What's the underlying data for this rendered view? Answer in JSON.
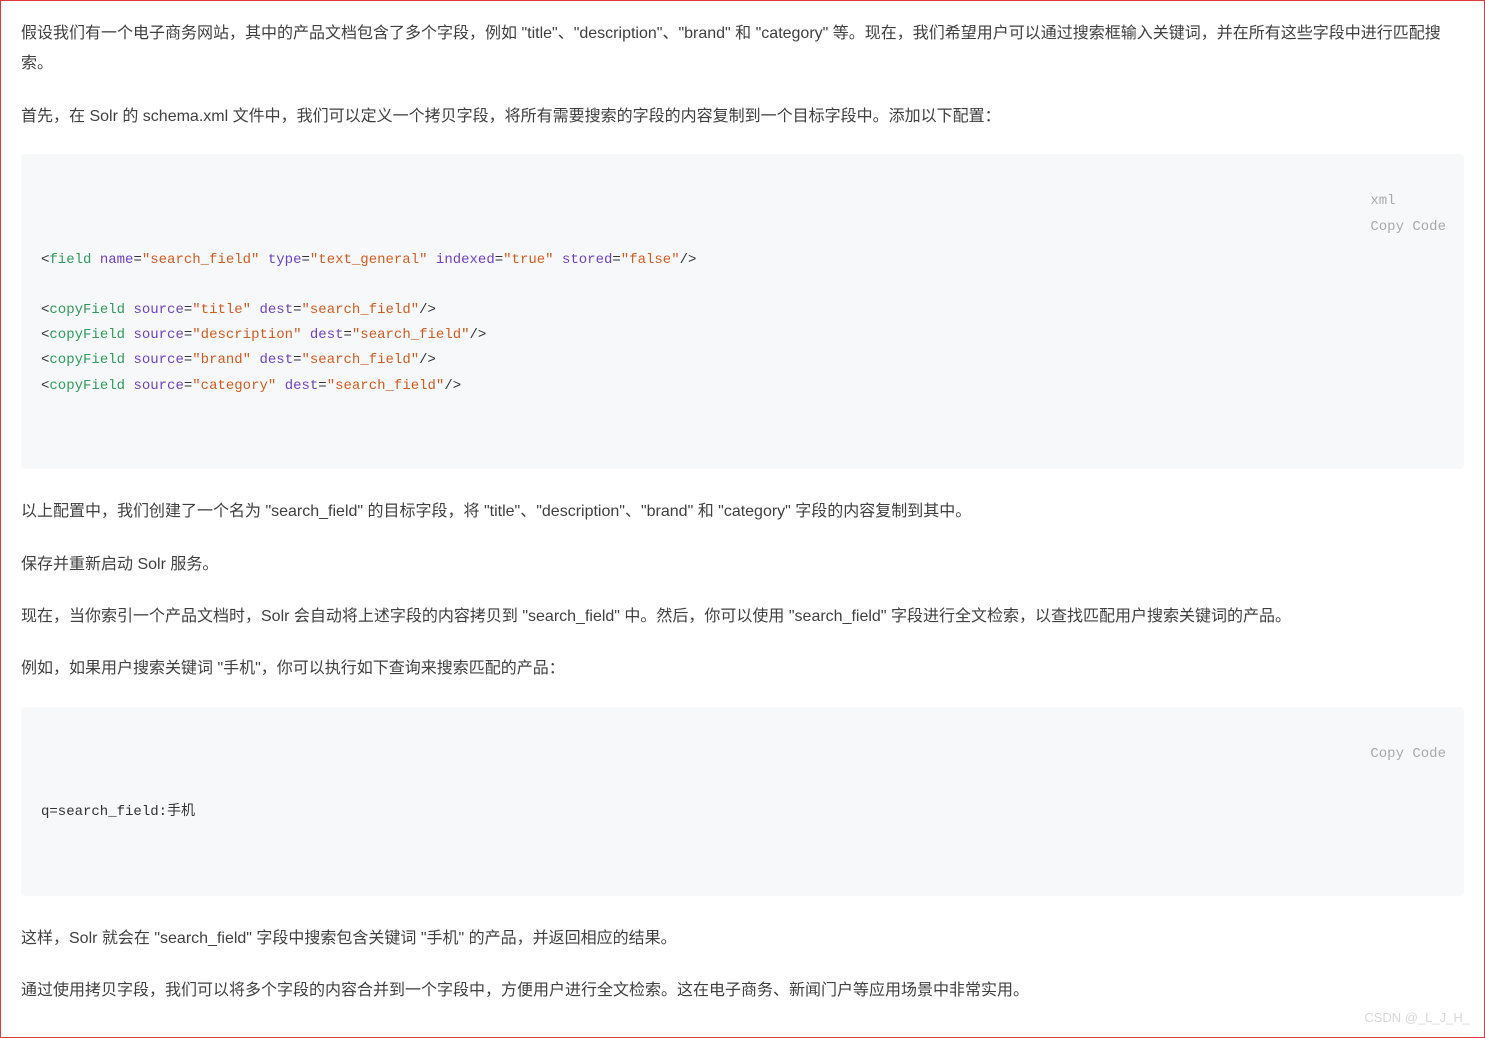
{
  "paragraphs": {
    "p1": "假设我们有一个电子商务网站，其中的产品文档包含了多个字段，例如 \"title\"、\"description\"、\"brand\" 和 \"category\" 等。现在，我们希望用户可以通过搜索框输入关键词，并在所有这些字段中进行匹配搜索。",
    "p2": "首先，在 Solr 的 schema.xml 文件中，我们可以定义一个拷贝字段，将所有需要搜索的字段的内容复制到一个目标字段中。添加以下配置：",
    "p3": "以上配置中，我们创建了一个名为 \"search_field\" 的目标字段，将 \"title\"、\"description\"、\"brand\" 和 \"category\" 字段的内容复制到其中。",
    "p4": "保存并重新启动 Solr 服务。",
    "p5": "现在，当你索引一个产品文档时，Solr 会自动将上述字段的内容拷贝到 \"search_field\" 中。然后，你可以使用 \"search_field\" 字段进行全文检索，以查找匹配用户搜索关键词的产品。",
    "p6": "例如，如果用户搜索关键词 \"手机\"，你可以执行如下查询来搜索匹配的产品：",
    "p7": "这样，Solr 就会在 \"search_field\" 字段中搜索包含关键词 \"手机\" 的产品，并返回相应的结果。",
    "p8": "通过使用拷贝字段，我们可以将多个字段的内容合并到一个字段中，方便用户进行全文检索。这在电子商务、新闻门户等应用场景中非常实用。"
  },
  "code1": {
    "lang": "xml",
    "copy": "Copy Code",
    "lines": [
      {
        "tag": "field",
        "attrs": [
          [
            "name",
            "search_field"
          ],
          [
            "type",
            "text_general"
          ],
          [
            "indexed",
            "true"
          ],
          [
            "stored",
            "false"
          ]
        ]
      },
      null,
      {
        "tag": "copyField",
        "attrs": [
          [
            "source",
            "title"
          ],
          [
            "dest",
            "search_field"
          ]
        ]
      },
      {
        "tag": "copyField",
        "attrs": [
          [
            "source",
            "description"
          ],
          [
            "dest",
            "search_field"
          ]
        ]
      },
      {
        "tag": "copyField",
        "attrs": [
          [
            "source",
            "brand"
          ],
          [
            "dest",
            "search_field"
          ]
        ]
      },
      {
        "tag": "copyField",
        "attrs": [
          [
            "source",
            "category"
          ],
          [
            "dest",
            "search_field"
          ]
        ]
      }
    ]
  },
  "code2": {
    "copy": "Copy Code",
    "text": "q=search_field:手机"
  },
  "watermark": "CSDN @_L_J_H_"
}
